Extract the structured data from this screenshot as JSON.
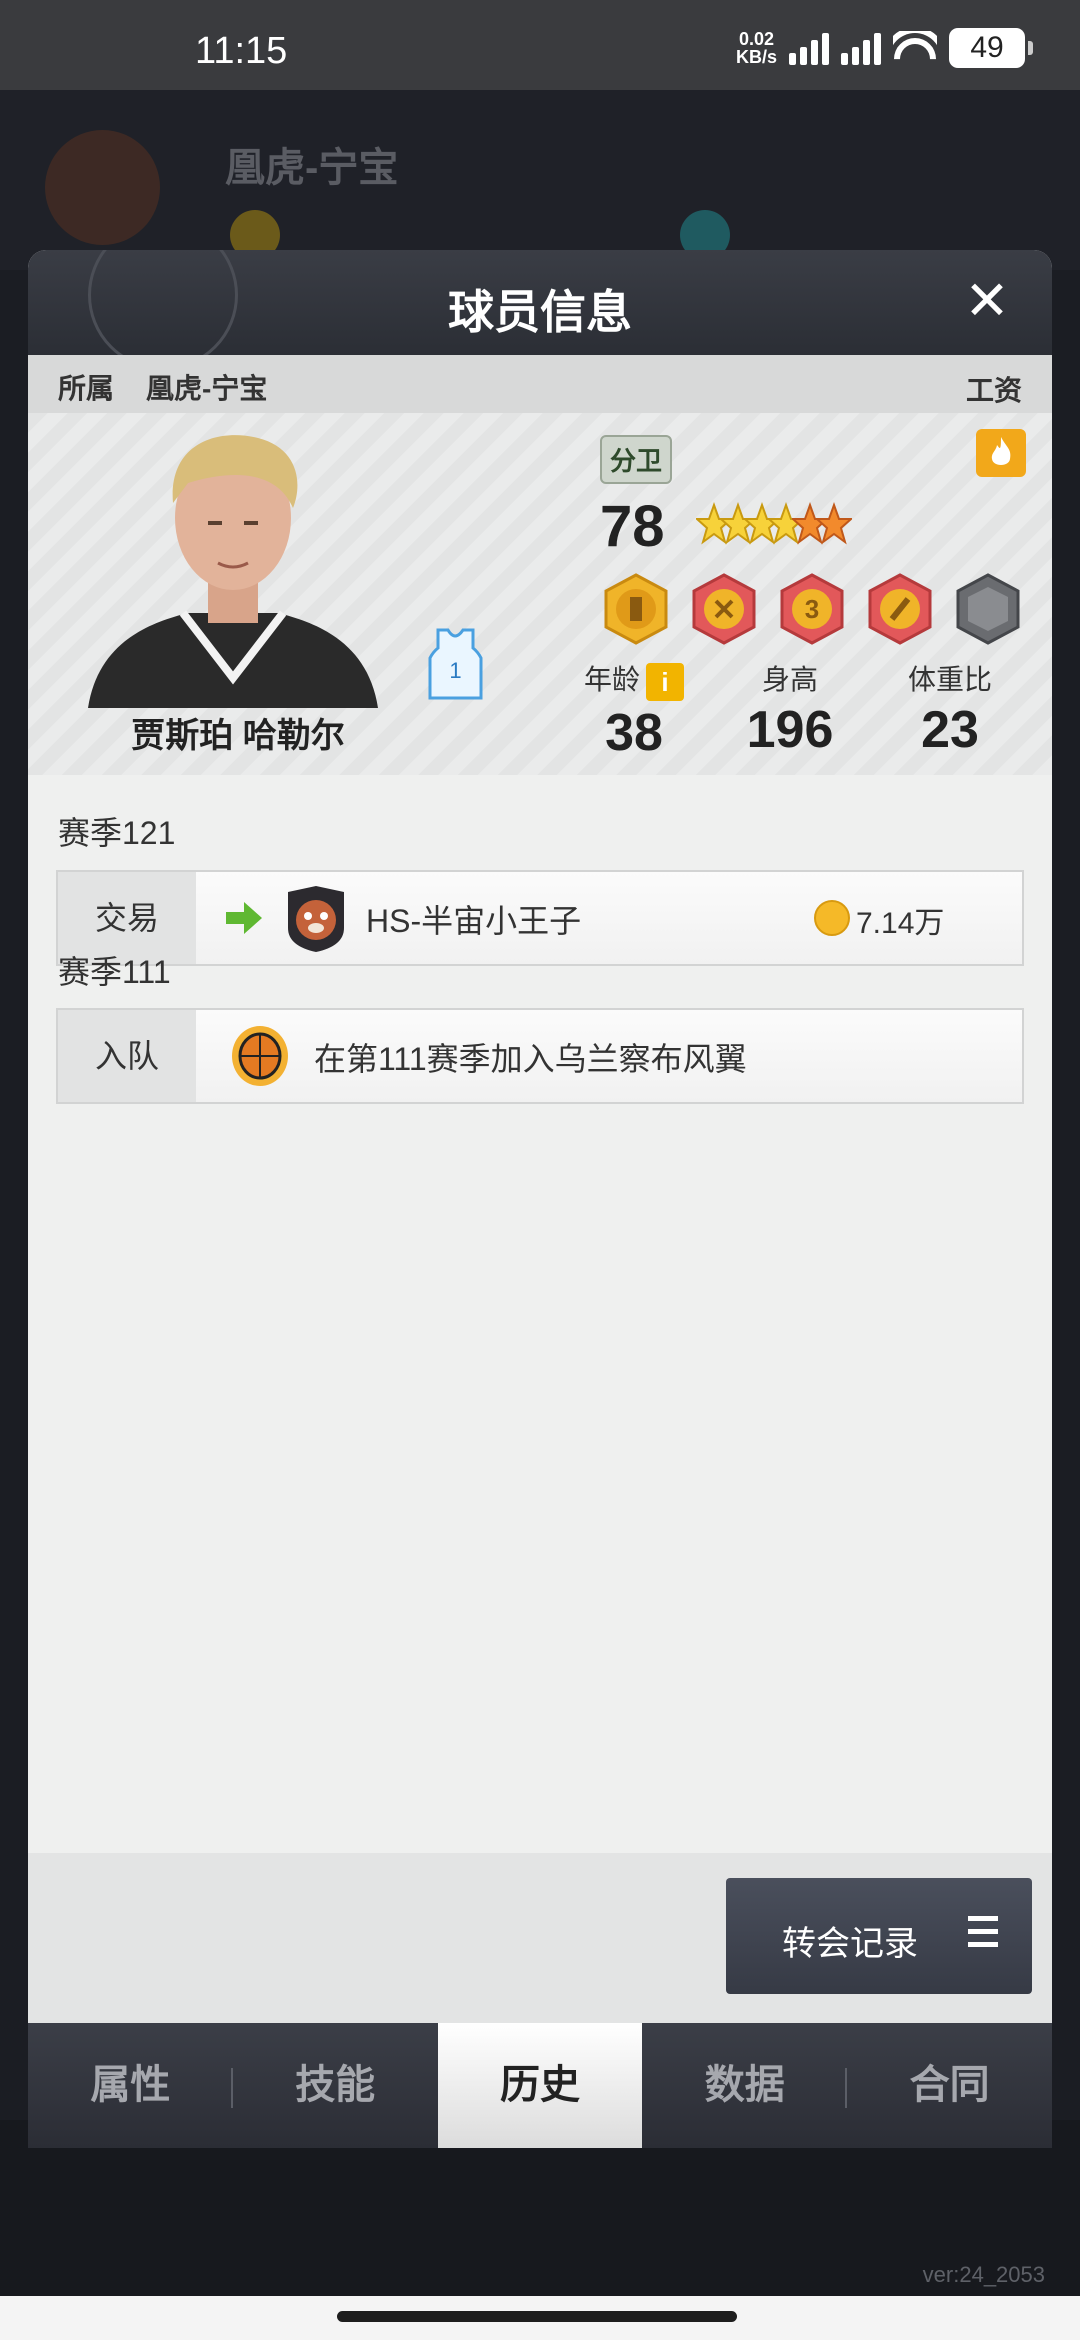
{
  "status_bar": {
    "time": "11:15",
    "net_speed_value": "0.02",
    "net_speed_unit": "KB/s",
    "battery": "49"
  },
  "background": {
    "team_name": "凰虎-宁宝"
  },
  "modal": {
    "title": "球员信息",
    "affiliation_label": "所属",
    "affiliation_team": "凰虎-宁宝",
    "wage_label": "工资"
  },
  "player": {
    "name": "贾斯珀 哈勒尔",
    "jersey_number": "1",
    "position": "分卫",
    "overall": "78",
    "stars": 6,
    "gold_stars": 4,
    "stats": [
      {
        "label": "年龄",
        "value": "38"
      },
      {
        "label": "身高",
        "value": "196"
      },
      {
        "label": "体重比",
        "value": "23"
      }
    ]
  },
  "history": [
    {
      "season": "赛季121",
      "type": "交易",
      "team": "HS-半宙小王子",
      "amount": "7.14万"
    },
    {
      "season": "赛季111",
      "type": "入队",
      "text": "在第111赛季加入乌兰察布风翼"
    }
  ],
  "transfer_button": {
    "label": "转会记录"
  },
  "tabs": [
    {
      "label": "属性",
      "active": false
    },
    {
      "label": "技能",
      "active": false
    },
    {
      "label": "历史",
      "active": true
    },
    {
      "label": "数据",
      "active": false
    },
    {
      "label": "合同",
      "active": false
    }
  ],
  "version": "ver:24_2053",
  "colors": {
    "accent_gold": "#f2b400",
    "coin": "#f5b928",
    "arrow_green": "#5fb832"
  }
}
